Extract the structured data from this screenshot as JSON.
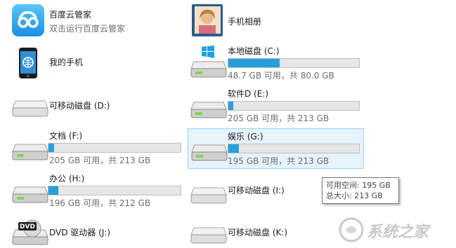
{
  "items": [
    {
      "name": "百度云管家",
      "subtitle": "双击运行百度云管家"
    },
    {
      "name": "手机相册"
    },
    {
      "name": "我的手机"
    },
    {
      "name": "本地磁盘 (C:)",
      "usage": "48.7 GB 可用，共 80.0 GB",
      "fill": 0.39
    },
    {
      "name": "可移动磁盘 (D:)"
    },
    {
      "name": "软件D (E:)",
      "usage": "205 GB 可用，共 213 GB",
      "fill": 0.04
    },
    {
      "name": "文档 (F:)",
      "usage": "205 GB 可用，共 213 GB",
      "fill": 0.04
    },
    {
      "name": "娱乐 (G:)",
      "usage": "195 GB 可用，共 213 GB",
      "fill": 0.08
    },
    {
      "name": "办公 (H:)",
      "usage": "196 GB 可用，共 212 GB",
      "fill": 0.075
    },
    {
      "name": "可移动磁盘 (I:)"
    },
    {
      "name": "DVD 驱动器 (J:)"
    },
    {
      "name": "可移动磁盘 (K:)"
    }
  ],
  "tooltip": {
    "line1": "可用空间: 195 GB",
    "line2": "总大小: 213 GB"
  },
  "watermark": {
    "text": "系统之家"
  },
  "colors": {
    "bar_fill": "#26a0da",
    "bar_bg": "#e6e6e6",
    "selection_bg": "#e5f3fb",
    "selection_border": "#9bd1f3"
  }
}
